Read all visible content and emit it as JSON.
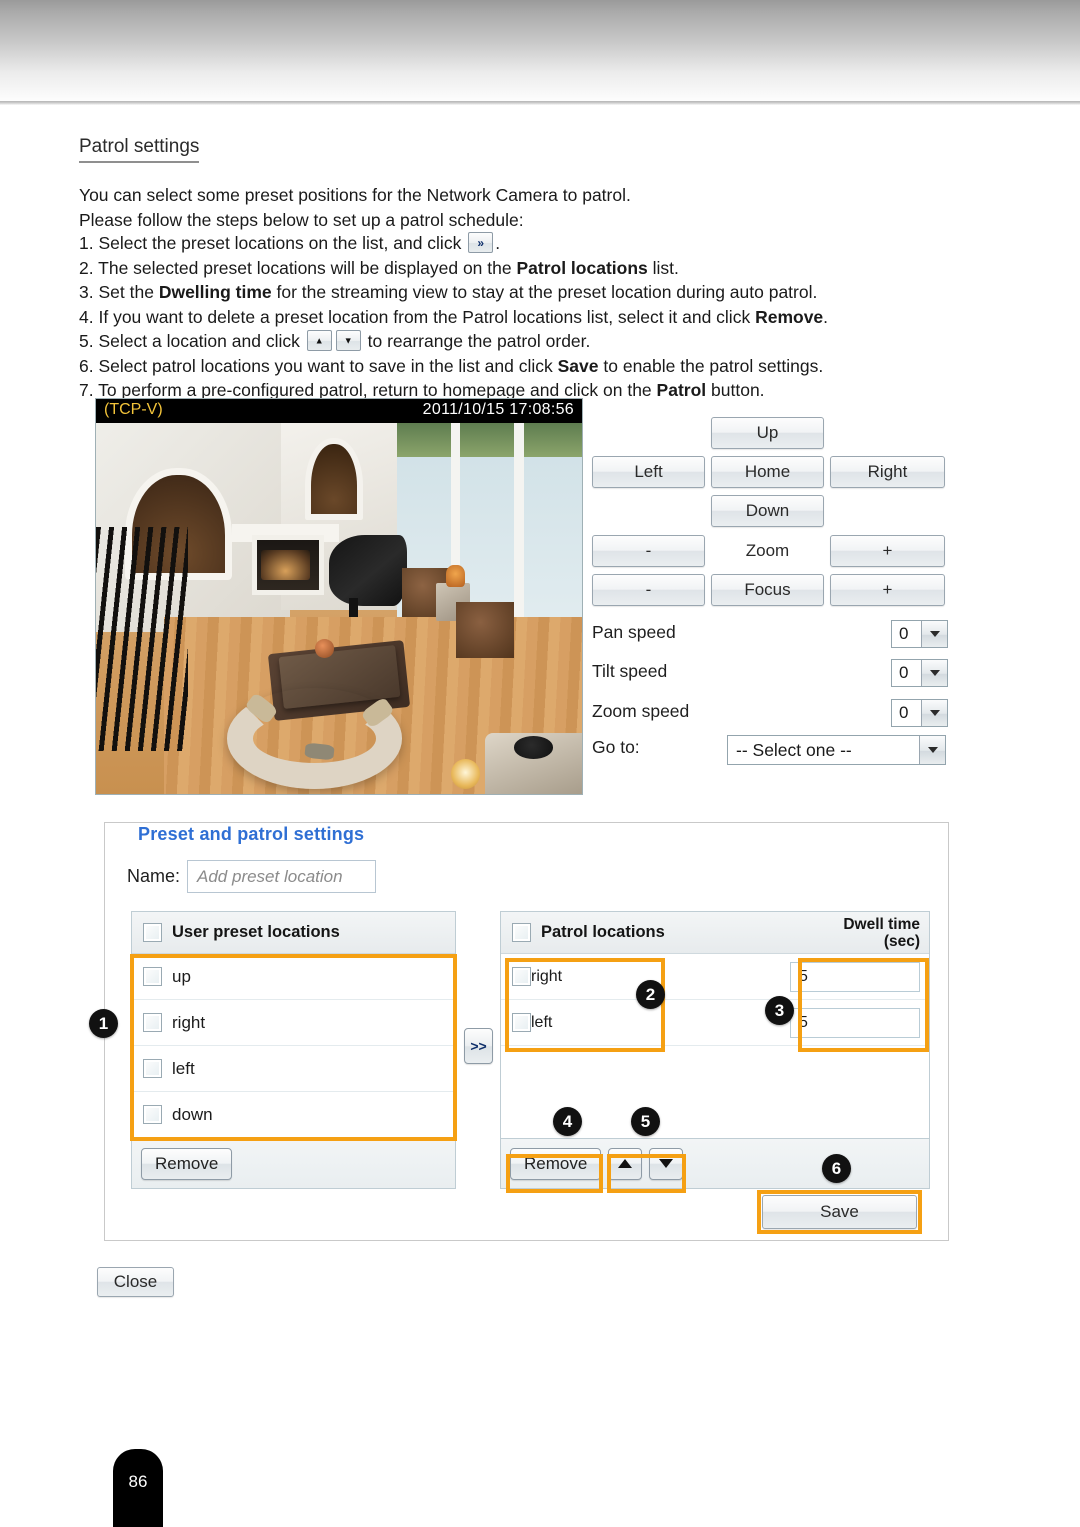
{
  "page": {
    "number": "86"
  },
  "doc": {
    "section_title": "Patrol settings",
    "intro_lines": [
      "You can select some preset positions for the Network Camera to patrol.",
      "Please follow the steps below to set up a patrol schedule:"
    ],
    "steps": [
      {
        "num": "1.",
        "pre": "Select the preset locations on the list, and click",
        "icon": "transfer-icon",
        "post": "."
      },
      {
        "num": "2.",
        "pre": "The selected preset locations will be displayed on the",
        "bold": "Patrol locations",
        "post": "list."
      },
      {
        "num": "3.",
        "pre": "Set the",
        "bold": "Dwelling time",
        "post": "for the streaming view to stay at the preset location during auto patrol."
      },
      {
        "num": "4.",
        "pre": "If you want to delete a preset location from the Patrol locations list, select it and click",
        "bold": "Remove",
        "post": "."
      },
      {
        "num": "5.",
        "pre": "Select a location and click",
        "icon": "up-down-arrow-icons",
        "post": "to rearrange the patrol order."
      },
      {
        "num": "6.",
        "pre": "Select patrol locations you want to save in the list and click",
        "bold": "Save",
        "post": "to enable the patrol settings."
      },
      {
        "num": "7.",
        "pre": "To perform a pre-configured patrol, return to homepage and click on the",
        "bold": "Patrol",
        "post": "button."
      }
    ]
  },
  "video": {
    "protocol": "(TCP-V)",
    "timestamp": "2011/10/15  17:08:56"
  },
  "ptz": {
    "up": "Up",
    "left": "Left",
    "home": "Home",
    "right": "Right",
    "down": "Down",
    "zoom_minus": "-",
    "zoom_label": "Zoom",
    "zoom_plus": "+",
    "focus_minus": "-",
    "focus_label": "Focus",
    "focus_plus": "+"
  },
  "speeds": {
    "pan_label": "Pan speed",
    "pan_value": "0",
    "tilt_label": "Tilt speed",
    "tilt_value": "0",
    "zoom_label": "Zoom speed",
    "zoom_value": "0",
    "goto_label": "Go to:",
    "goto_value": "-- Select one --"
  },
  "panel": {
    "legend": "Preset and patrol settings",
    "name_label": "Name:",
    "name_placeholder": "Add preset location",
    "user_list": {
      "header": "User preset locations",
      "rows": [
        {
          "label": "up"
        },
        {
          "label": "right"
        },
        {
          "label": "left"
        },
        {
          "label": "down"
        }
      ],
      "remove_label": "Remove"
    },
    "patrol_list": {
      "header": "Patrol locations",
      "dwell_header_line1": "Dwell time",
      "dwell_header_line2": "(sec)",
      "rows": [
        {
          "label": "right",
          "dwell": "5"
        },
        {
          "label": "left",
          "dwell": "5"
        }
      ],
      "remove_label": "Remove",
      "move_up_icon": "triangle-up-icon",
      "move_down_icon": "triangle-down-icon",
      "save_label": "Save"
    },
    "transfer_label": ">>"
  },
  "close_label": "Close",
  "callouts": [
    {
      "n": "1"
    },
    {
      "n": "2"
    },
    {
      "n": "3"
    },
    {
      "n": "4"
    },
    {
      "n": "5"
    },
    {
      "n": "6"
    }
  ],
  "colors": {
    "highlight": "#f5a013",
    "legend_blue": "#2f6fd4",
    "osd_yellow": "#f3c43a"
  }
}
